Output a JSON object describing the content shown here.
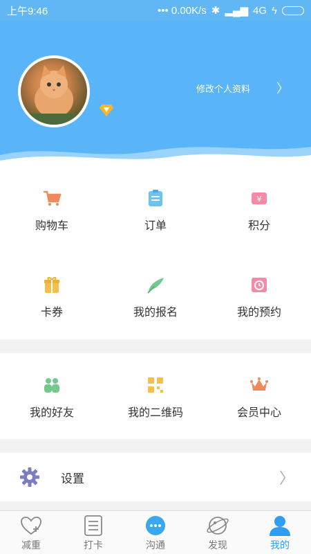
{
  "status_bar": {
    "time": "上午9:46",
    "network": "••• 0.00K/s",
    "signal_type": "4G"
  },
  "header": {
    "edit_profile_label": "修改个人资料",
    "colors": {
      "background": "#59b5f7"
    }
  },
  "menu": {
    "row1": [
      {
        "label": "购物车",
        "icon": "cart-icon",
        "color": "#f08a5a"
      },
      {
        "label": "订单",
        "icon": "order-icon",
        "color": "#6ec2f0"
      },
      {
        "label": "积分",
        "icon": "points-icon",
        "color": "#f58aa6"
      }
    ],
    "row2": [
      {
        "label": "卡券",
        "icon": "gift-icon",
        "color": "#f5c04a"
      },
      {
        "label": "我的报名",
        "icon": "signup-icon",
        "color": "#73c98c"
      },
      {
        "label": "我的预约",
        "icon": "appointment-icon",
        "color": "#f58aa6"
      }
    ],
    "row3": [
      {
        "label": "我的好友",
        "icon": "friends-icon",
        "color": "#73c98c"
      },
      {
        "label": "我的二维码",
        "icon": "qrcode-icon",
        "color": "#f5c04a"
      },
      {
        "label": "会员中心",
        "icon": "crown-icon",
        "color": "#f08a5a"
      }
    ]
  },
  "settings": {
    "label": "设置",
    "icon": "gear-icon"
  },
  "tabbar": [
    {
      "label": "减重",
      "icon": "heart-plus-icon",
      "active": false
    },
    {
      "label": "打卡",
      "icon": "checklist-icon",
      "active": false
    },
    {
      "label": "沟通",
      "icon": "chat-icon",
      "active": false
    },
    {
      "label": "发现",
      "icon": "planet-icon",
      "active": false
    },
    {
      "label": "我的",
      "icon": "person-icon",
      "active": true
    }
  ],
  "colors": {
    "accent": "#2f9ef0",
    "status_bar": "#61b7f3"
  }
}
